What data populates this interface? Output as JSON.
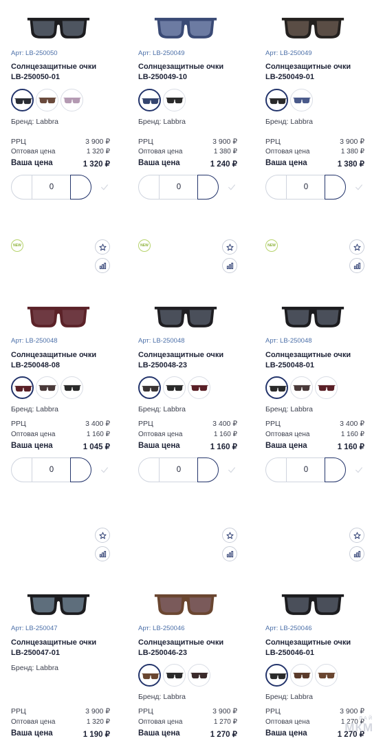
{
  "labels": {
    "rrc": "РРЦ",
    "wholesale": "Оптовая цена",
    "your_price": "Ваша цена",
    "new_badge": "NEW"
  },
  "watermark": {
    "top": "ЛАЙ",
    "main": "МКМ"
  },
  "products": [
    {
      "art": "Арт: LB-250050",
      "title1": "Солнцезащитные очки",
      "title2": "LB-250050-01",
      "brand": "Бренд: Labbra",
      "rrc": "3 900 ₽",
      "wholesale": "1 320 ₽",
      "your_price": "1 320 ₽",
      "qty": "0",
      "frame_color": "#1c1c1f",
      "lens_color": "#4e5560",
      "variants": [
        "#2a2c33",
        "#6a4a3c",
        "#b49ab2"
      ],
      "selected": 0,
      "is_new": false
    },
    {
      "art": "Арт: LB-250049",
      "title1": "Солнцезащитные очки",
      "title2": "LB-250049-10",
      "brand": "Бренд: Labbra",
      "rrc": "3 900 ₽",
      "wholesale": "1 380 ₽",
      "your_price": "1 240 ₽",
      "qty": "0",
      "frame_color": "#3a4a75",
      "lens_color": "#6c7ba2",
      "variants": [
        "#34446e",
        "#2b2b2b"
      ],
      "selected": 0,
      "is_new": false
    },
    {
      "art": "Арт: LB-250049",
      "title1": "Солнцезащитные очки",
      "title2": "LB-250049-01",
      "brand": "Бренд: Labbra",
      "rrc": "3 900 ₽",
      "wholesale": "1 380 ₽",
      "your_price": "1 380 ₽",
      "qty": "0",
      "frame_color": "#24211f",
      "lens_color": "#5a4d45",
      "variants": [
        "#2a2a2a",
        "#4a5a8a"
      ],
      "selected": 0,
      "is_new": false
    },
    {
      "art": "Арт: LB-250048",
      "title1": "Солнцезащитные очки",
      "title2": "LB-250048-08",
      "brand": "Бренд: Labbra",
      "rrc": "3 400 ₽",
      "wholesale": "1 160 ₽",
      "your_price": "1 045 ₽",
      "qty": "0",
      "frame_color": "#5b2228",
      "lens_color": "#6e3a42",
      "variants": [
        "#5a2027",
        "#4a3a3a",
        "#2a2a2a"
      ],
      "selected": 0,
      "is_new": true
    },
    {
      "art": "Арт: LB-250048",
      "title1": "Солнцезащитные очки",
      "title2": "LB-250048-23",
      "brand": "Бренд: Labbra",
      "rrc": "3 400 ₽",
      "wholesale": "1 160 ₽",
      "your_price": "1 160 ₽",
      "qty": "0",
      "frame_color": "#1f1e22",
      "lens_color": "#4a4f5a",
      "variants": [
        "#3a3434",
        "#2a2a2a",
        "#5a2027"
      ],
      "selected": 0,
      "is_new": true
    },
    {
      "art": "Арт: LB-250048",
      "title1": "Солнцезащитные очки",
      "title2": "LB-250048-01",
      "brand": "Бренд: Labbra",
      "rrc": "3 400 ₽",
      "wholesale": "1 160 ₽",
      "your_price": "1 160 ₽",
      "qty": "0",
      "frame_color": "#1c1c1f",
      "lens_color": "#4a4f5a",
      "variants": [
        "#2a2a2a",
        "#4a3a3a",
        "#5a2027"
      ],
      "selected": 0,
      "is_new": true
    },
    {
      "art": "Арт: LB-250047",
      "title1": "Солнцезащитные очки",
      "title2": "LB-250047-01",
      "brand": "Бренд: Labbra",
      "rrc": "3 900 ₽",
      "wholesale": "1 320 ₽",
      "your_price": "1 190 ₽",
      "qty": "0",
      "frame_color": "#1c1c1f",
      "lens_color": "#5e6e7c",
      "variants": [],
      "selected": -1,
      "is_new": false
    },
    {
      "art": "Арт: LB-250046",
      "title1": "Солнцезащитные очки",
      "title2": "LB-250046-23",
      "brand": "Бренд: Labbra",
      "rrc": "3 900 ₽",
      "wholesale": "1 270 ₽",
      "your_price": "1 270 ₽",
      "qty": "0",
      "frame_color": "#6a4630",
      "lens_color": "#7a5a5a",
      "variants": [
        "#6a4630",
        "#2a2a2a",
        "#3a2a2a"
      ],
      "selected": 0,
      "is_new": false
    },
    {
      "art": "Арт: LB-250046",
      "title1": "Солнцезащитные очки",
      "title2": "LB-250046-01",
      "brand": "Бренд: Labbra",
      "rrc": "3 900 ₽",
      "wholesale": "1 270 ₽",
      "your_price": "1 270 ₽",
      "qty": "0",
      "frame_color": "#1c1c1f",
      "lens_color": "#4a4f5a",
      "variants": [
        "#2a2a2a",
        "#5a3a2a",
        "#6a4630"
      ],
      "selected": 0,
      "is_new": false
    }
  ]
}
